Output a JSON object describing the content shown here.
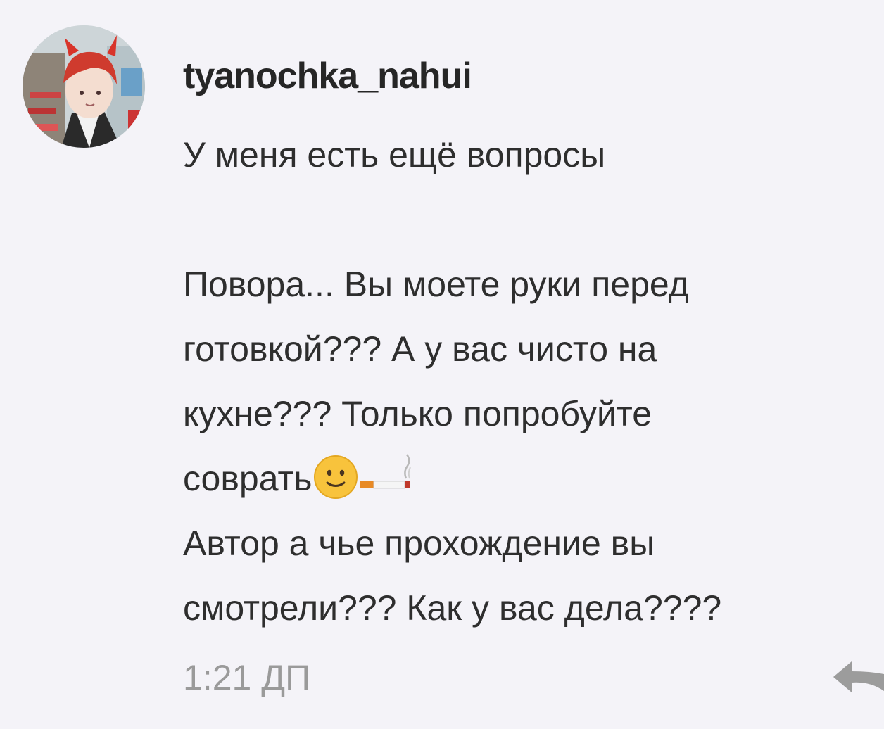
{
  "comment": {
    "username": "tyanochka_nahui",
    "avatar_icon": "avatar-image",
    "lines": [
      "У меня есть ещё вопросы",
      "",
      "Повора... Вы моете руки перед",
      "готовкой??? А у вас чисто на",
      "кухне??? Только попробуйте",
      "соврать",
      "Автор а чье прохождение вы",
      "смотрели??? Как у вас дела????"
    ],
    "emojis": [
      "slightly-smiling-face-emoji",
      "cigarette-emoji"
    ],
    "timestamp": "1:21 ДП",
    "reply_icon": "reply-arrow-icon"
  },
  "colors": {
    "background": "#f4f3f8",
    "text": "#2e2e2e",
    "timestamp": "#9a9a9a",
    "reply_icon": "#9c9c9c"
  }
}
